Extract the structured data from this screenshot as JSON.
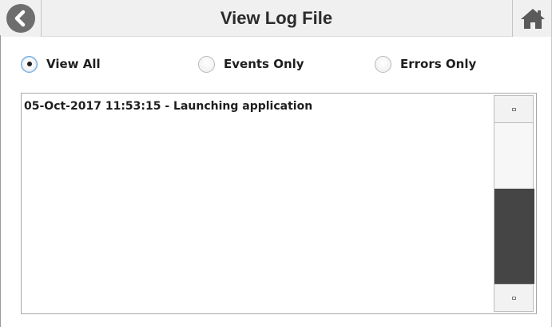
{
  "header": {
    "title": "View Log File",
    "back_icon": "back-arrow-icon",
    "home_icon": "home-icon"
  },
  "filters": {
    "selected": "view_all",
    "options": [
      {
        "id": "view_all",
        "label": "View All"
      },
      {
        "id": "events_only",
        "label": "Events Only"
      },
      {
        "id": "errors_only",
        "label": "Errors Only"
      }
    ]
  },
  "log": {
    "lines": [
      "05-Oct-2017 11:53:15 - Launching application"
    ]
  },
  "colors": {
    "header_bg": "#f0f0f0",
    "title_text": "#2b2b2b",
    "back_circle": "#6e6e6e",
    "radio_selected_ring": "#6aa5da",
    "scroll_thumb": "#454545"
  }
}
